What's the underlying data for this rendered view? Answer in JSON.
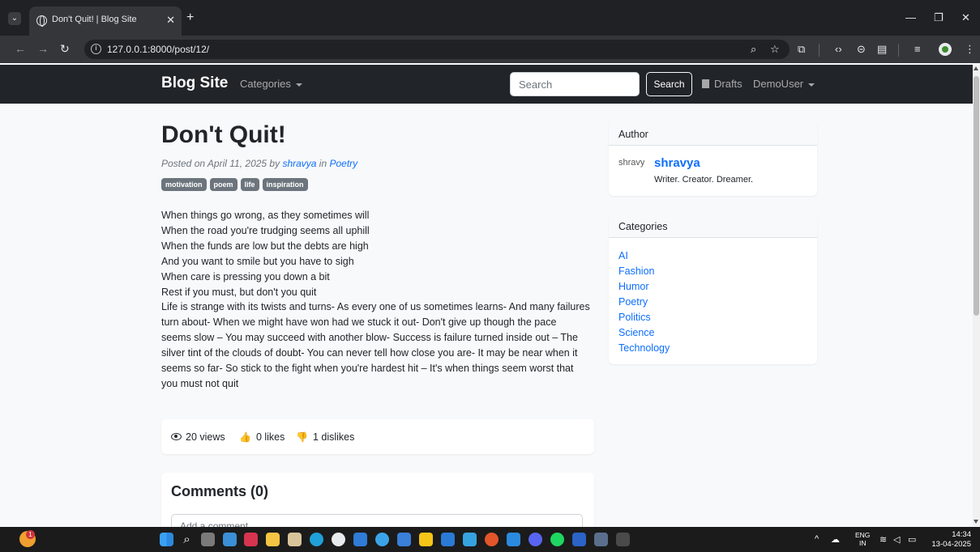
{
  "browser": {
    "tab_title": "Don't Quit! | Blog Site",
    "url": "127.0.0.1:8000/post/12/"
  },
  "site": {
    "brand": "Blog Site",
    "categories_label": "Categories",
    "search_placeholder": "Search",
    "search_button": "Search",
    "drafts_label": "Drafts",
    "user_label": "DemoUser"
  },
  "post": {
    "title": "Don't Quit!",
    "meta_prefix": "Posted on April 11, 2025 by ",
    "author": "shravya",
    "meta_in": " in ",
    "category": "Poetry",
    "tags": [
      "motivation",
      "poem",
      "life",
      "inspiration"
    ],
    "body_lines": [
      "When things go wrong, as they sometimes will",
      "When the road you're trudging seems all uphill",
      "When the funds are low but the debts are high",
      "And you want to smile but you have to sigh",
      "When care is pressing you down a bit",
      "Rest if you must, but don't you quit",
      "Life is strange with its twists and turns- As every one of us sometimes learns- And many failures",
      "turn about- When we might have won had we stuck it out- Don't give up though the pace",
      "seems slow – You may succeed with another blow- Success is failure turned inside out – The",
      "silver tint of the clouds of doubt- You can never tell how close you are- It may be near when it",
      "seems so far- So stick to the fight when you're hardest hit – It's when things seem worst that",
      "you must not quit"
    ],
    "views": "20 views",
    "likes": "0 likes",
    "dislikes": "1 dislikes"
  },
  "comments": {
    "title": "Comments (0)",
    "placeholder": "Add a comment..."
  },
  "sidebar": {
    "author_header": "Author",
    "avatar_alt": "shravya",
    "author_name": "shravya",
    "author_bio": "Writer. Creator. Dreamer.",
    "categories_header": "Categories",
    "categories": [
      "AI",
      "Fashion",
      "Humor",
      "Poetry",
      "Politics",
      "Science",
      "Technology"
    ]
  },
  "taskbar": {
    "lang_line1": "ENG",
    "lang_line2": "IN",
    "time": "14:34",
    "date": "13-04-2025",
    "notification_count": "1"
  }
}
